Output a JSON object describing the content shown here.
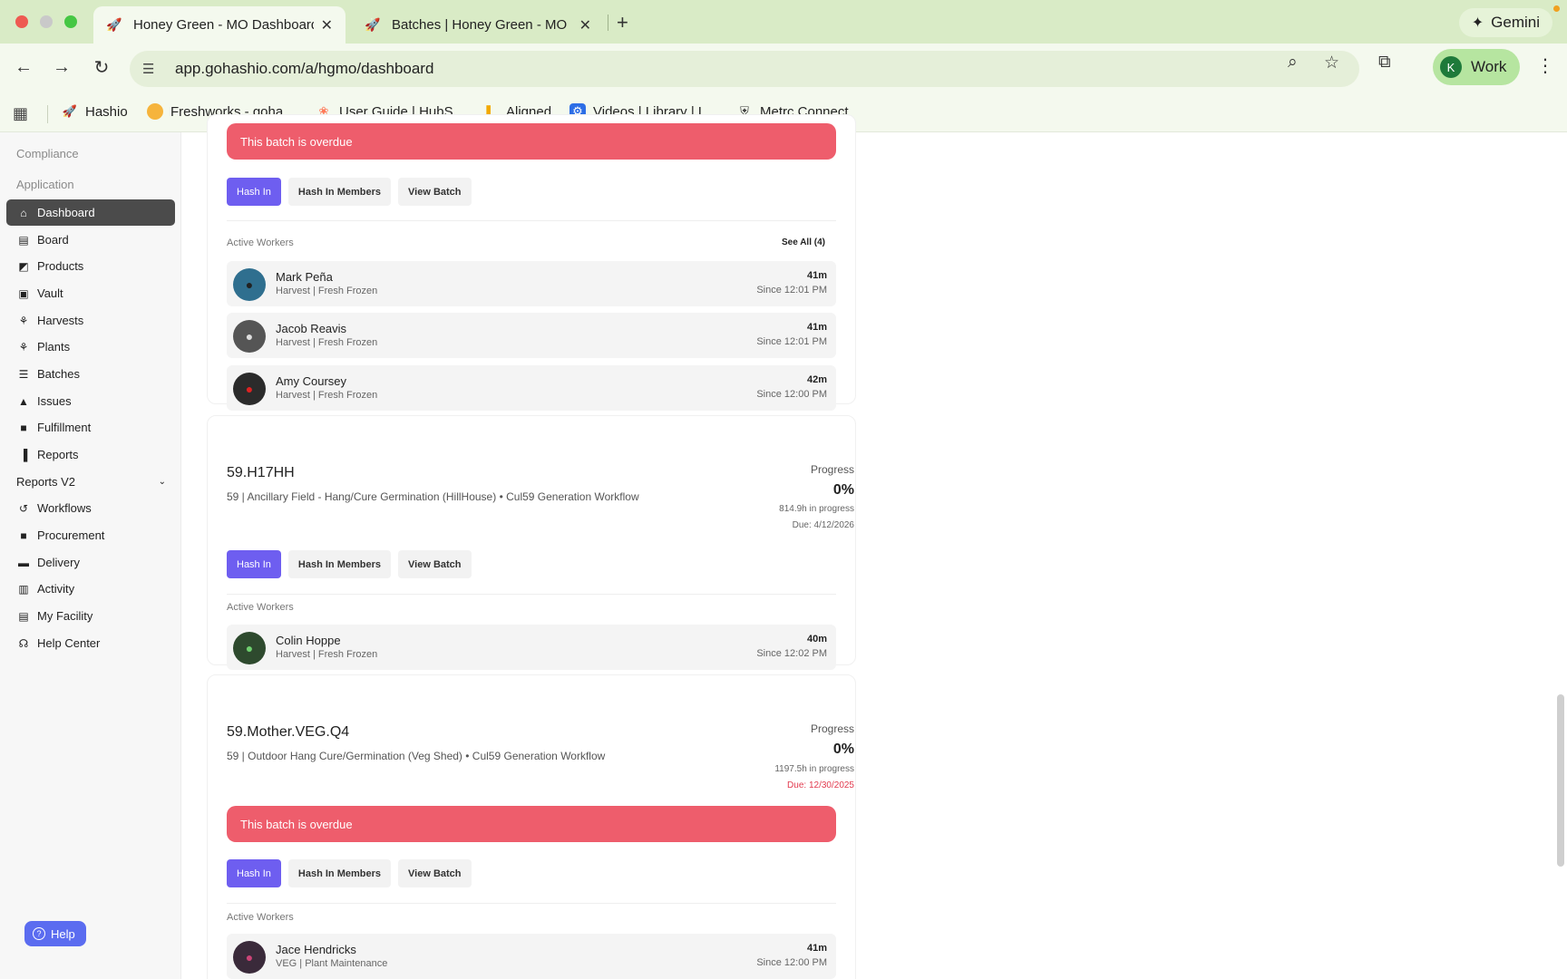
{
  "browser": {
    "tabs": [
      {
        "title": "Honey Green - MO Dashboard",
        "active": true
      },
      {
        "title": "Batches | Honey Green - MO",
        "active": false
      }
    ],
    "new_tab": "+",
    "gemini_label": "Gemini",
    "url": "app.gohashio.com/a/hgmo/dashboard",
    "profile_initial": "K",
    "profile_label": "Work",
    "bookmarks": [
      {
        "label": "Hashio",
        "icon": "rocket-icon"
      },
      {
        "label": "Freshworks - goha...",
        "icon": "freshworks-icon"
      },
      {
        "label": "User Guide | HubS...",
        "icon": "hubspot-icon"
      },
      {
        "label": "Aligned",
        "icon": "aligned-icon"
      },
      {
        "label": "Videos | Library | L...",
        "icon": "gear-icon"
      },
      {
        "label": "Metrc Connect",
        "icon": "shield-icon"
      }
    ]
  },
  "sidebar": {
    "sections": {
      "compliance": "Compliance",
      "application": "Application"
    },
    "items": [
      {
        "label": "Dashboard",
        "icon": "home-icon",
        "active": true
      },
      {
        "label": "Board",
        "icon": "board-icon"
      },
      {
        "label": "Products",
        "icon": "products-icon"
      },
      {
        "label": "Vault",
        "icon": "vault-icon"
      },
      {
        "label": "Harvests",
        "icon": "harvests-icon"
      },
      {
        "label": "Plants",
        "icon": "plants-icon"
      },
      {
        "label": "Batches",
        "icon": "batches-icon"
      },
      {
        "label": "Issues",
        "icon": "warning-icon"
      },
      {
        "label": "Fulfillment",
        "icon": "fulfillment-icon"
      },
      {
        "label": "Reports",
        "icon": "chart-icon"
      },
      {
        "label": "Reports V2",
        "icon": "",
        "expandable": true
      },
      {
        "label": "Workflows",
        "icon": "workflows-icon"
      },
      {
        "label": "Procurement",
        "icon": "bag-icon"
      },
      {
        "label": "Delivery",
        "icon": "truck-icon"
      },
      {
        "label": "Activity",
        "icon": "activity-icon"
      },
      {
        "label": "My Facility",
        "icon": "facility-icon"
      },
      {
        "label": "Help Center",
        "icon": "headset-icon"
      }
    ],
    "help_button": "Help"
  },
  "colors": {
    "primary": "#6e5ef0",
    "overdue": "#ee5d6c",
    "due_late": "#e23a4e",
    "sidebar_active": "#4b4b4b"
  },
  "batches": [
    {
      "overdue_text": "This batch is overdue",
      "buttons": {
        "hash_in": "Hash In",
        "hash_in_members": "Hash In Members",
        "view_batch": "View Batch"
      },
      "active_workers_label": "Active Workers",
      "see_all": "See All (4)",
      "workers": [
        {
          "name": "Mark Peña",
          "role": "Harvest | Fresh Frozen",
          "duration": "41m",
          "since": "Since 12:01 PM"
        },
        {
          "name": "Jacob Reavis",
          "role": "Harvest | Fresh Frozen",
          "duration": "41m",
          "since": "Since 12:01 PM"
        },
        {
          "name": "Amy Coursey",
          "role": "Harvest | Fresh Frozen",
          "duration": "42m",
          "since": "Since 12:00 PM"
        }
      ]
    },
    {
      "title": "59.H17HH",
      "subtitle": "59 | Ancillary Field - Hang/Cure Germination (HillHouse) • Cul59 Generation Workflow",
      "progress_label": "Progress",
      "progress_value": "0%",
      "hours": "814.9h in progress",
      "due": "Due: 4/12/2026",
      "buttons": {
        "hash_in": "Hash In",
        "hash_in_members": "Hash In Members",
        "view_batch": "View Batch"
      },
      "active_workers_label": "Active Workers",
      "workers": [
        {
          "name": "Colin Hoppe",
          "role": "Harvest | Fresh Frozen",
          "duration": "40m",
          "since": "Since 12:02 PM"
        }
      ]
    },
    {
      "title": "59.Mother.VEG.Q4",
      "subtitle": "59 | Outdoor Hang Cure/Germination (Veg Shed) • Cul59 Generation Workflow",
      "progress_label": "Progress",
      "progress_value": "0%",
      "hours": "1197.5h in progress",
      "due": "Due: 12/30/2025",
      "overdue_text": "This batch is overdue",
      "buttons": {
        "hash_in": "Hash In",
        "hash_in_members": "Hash In Members",
        "view_batch": "View Batch"
      },
      "active_workers_label": "Active Workers",
      "workers": [
        {
          "name": "Jace Hendricks",
          "role": "VEG | Plant Maintenance",
          "duration": "41m",
          "since": "Since 12:00 PM"
        }
      ]
    }
  ]
}
